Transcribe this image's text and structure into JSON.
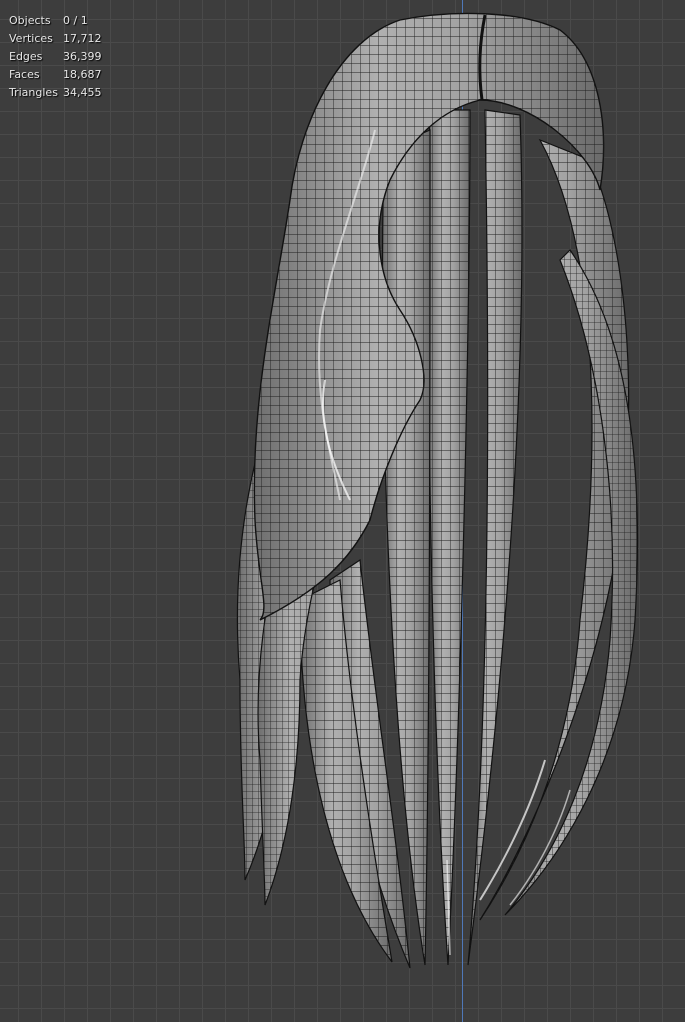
{
  "overlay": {
    "stats": [
      {
        "label": "Objects",
        "value": "0 / 1"
      },
      {
        "label": "Vertices",
        "value": "17,712"
      },
      {
        "label": "Edges",
        "value": "36,399"
      },
      {
        "label": "Faces",
        "value": "18,687"
      },
      {
        "label": "Triangles",
        "value": "34,455"
      }
    ]
  },
  "colors": {
    "background": "#3d3d3d",
    "grid_line": "#4a4a4a",
    "axis_line": "#4f78b8",
    "mesh_fill": "#9a9a9a",
    "wire": "#1a1a1a"
  }
}
